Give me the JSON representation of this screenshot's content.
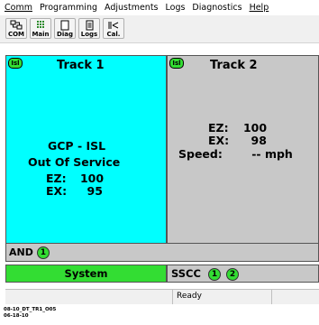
{
  "menu": [
    "Comm",
    "Programming",
    "Adjustments",
    "Logs",
    "Diagnostics",
    "Help"
  ],
  "toolbar": [
    {
      "label": "COM",
      "icon": "com-icon"
    },
    {
      "label": "Main",
      "icon": "grid-icon"
    },
    {
      "label": "Diag",
      "icon": "diag-icon"
    },
    {
      "label": "Logs",
      "icon": "logs-icon"
    },
    {
      "label": "Cal.",
      "icon": "calibration-icon"
    }
  ],
  "track1": {
    "badge": "Isl",
    "title": "Track 1",
    "line1": "GCP - ISL",
    "line2": "Out Of Service",
    "ez_label": "EZ:",
    "ez_value": "100",
    "ex_label": "EX:",
    "ex_value": "95",
    "color": "#00ffff"
  },
  "track2": {
    "badge": "Isl",
    "title": "Track 2",
    "ez_label": "EZ:",
    "ez_value": "100",
    "ex_label": "EX:",
    "ex_value": "98",
    "speed_label": "Speed:",
    "speed_value": "-- mph",
    "color": "#c8c8c8"
  },
  "and_row": {
    "label": "AND",
    "badge": "1"
  },
  "system": {
    "label": "System",
    "color": "#33dd33"
  },
  "sscc": {
    "label": "SSCC",
    "badges": [
      "1",
      "2"
    ]
  },
  "status": {
    "text": "Ready"
  },
  "footer": {
    "line1": "08-10_DT_TR1_O05",
    "line2": "06-18-10"
  }
}
